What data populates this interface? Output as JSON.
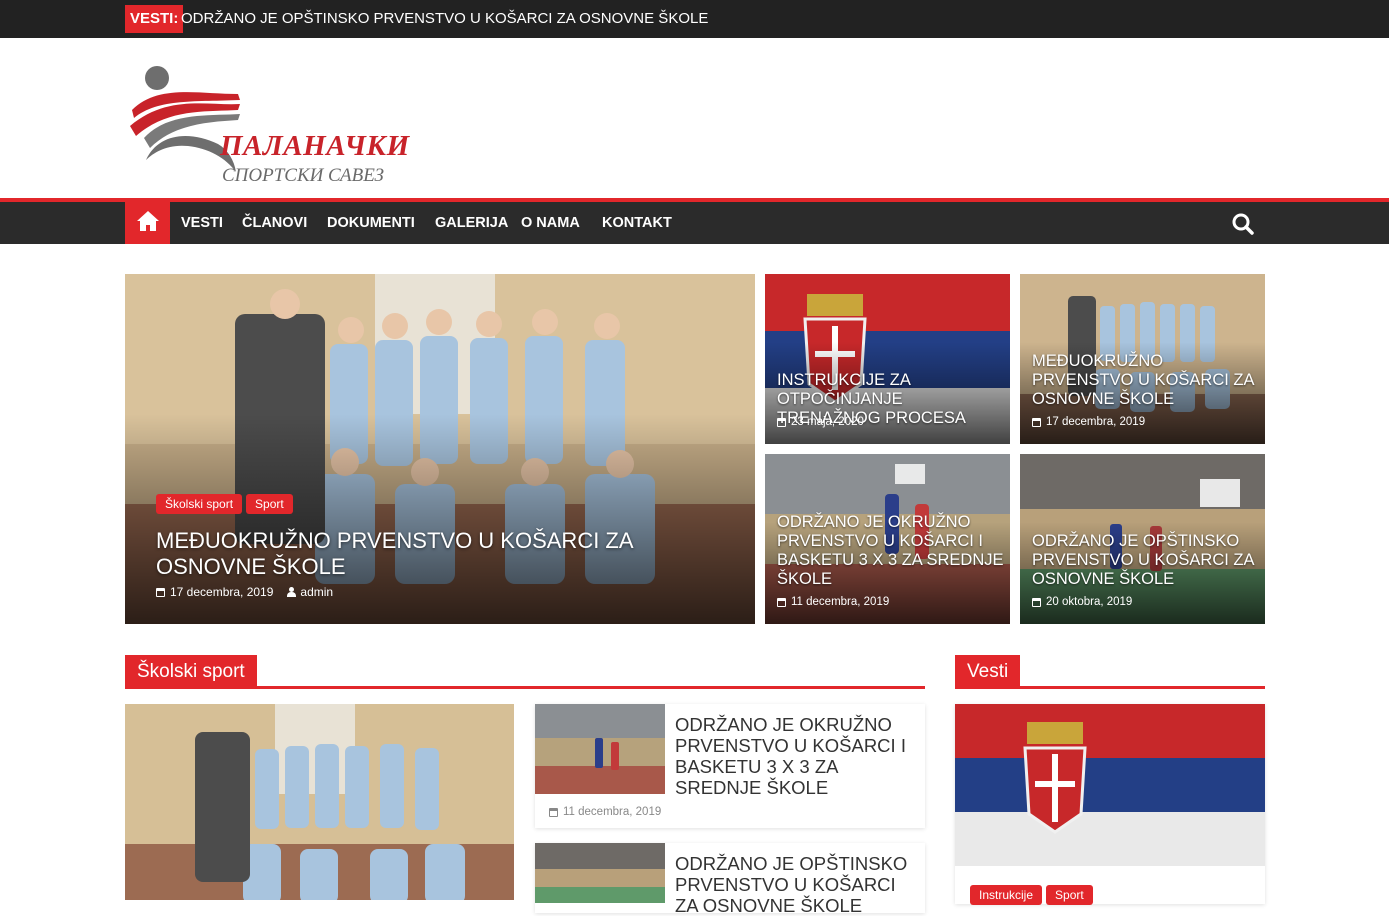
{
  "ticker": {
    "label": "VESTI:",
    "text": "ODRŽANO JE OPŠTINSKO PRVENSTVO U KOŠARCI ZA OSNOVNE ŠKOLE"
  },
  "logo": {
    "line1": "ПАЛАНАЧКИ",
    "line2": "СПОРТСКИ САВЕЗ"
  },
  "nav": {
    "items": [
      "VESTI",
      "ČLANOVI",
      "DOKUMENTI",
      "GALERIJA",
      "O NAMA",
      "KONTAKT"
    ]
  },
  "featured": {
    "tags": [
      "Školski sport",
      "Sport"
    ],
    "title": "MEĐUOKRUŽNO PRVENSTVO U KOŠARCI ZA OSNOVNE ŠKOLE",
    "date": "17 decembra, 2019",
    "author": "admin"
  },
  "tiles": [
    {
      "title": "INSTRUKCIJE ZA OTPOČINJANJE TRENAŽNOG PROCESA",
      "date": "23 maja, 2020"
    },
    {
      "title": "MEĐUOKRUŽNO PRVENSTVO U KOŠARCI ZA OSNOVNE ŠKOLE",
      "date": "17 decembra, 2019"
    },
    {
      "title": "ODRŽANO JE OKRUŽNO PRVENSTVO U KOŠARCI I BASKETU 3 X 3 ZA SREDNJE ŠKOLE",
      "date": "11 decembra, 2019"
    },
    {
      "title": "ODRŽANO JE OPŠTINSKO PRVENSTVO U KOŠARCI ZA OSNOVNE ŠKOLE",
      "date": "20 oktobra, 2019"
    }
  ],
  "school_section": {
    "label": "Školski sport",
    "list": [
      {
        "title": "ODRŽANO JE OKRUŽNO PRVENSTVO U KOŠARCI I BASKETU 3 X 3 ZA SREDNJE ŠKOLE",
        "date": "11 decembra, 2019"
      },
      {
        "title": "ODRŽANO JE OPŠTINSKO PRVENSTVO U KOŠARCI ZA OSNOVNE ŠKOLE",
        "date": ""
      }
    ]
  },
  "side_section": {
    "label": "Vesti",
    "tags": [
      "Instrukcije",
      "Sport"
    ]
  },
  "colors": {
    "accent": "#e2272b",
    "dark": "#222222",
    "nav": "#2b2b2b"
  },
  "icons": [
    "home-icon",
    "search-icon",
    "calendar-icon",
    "user-icon"
  ]
}
